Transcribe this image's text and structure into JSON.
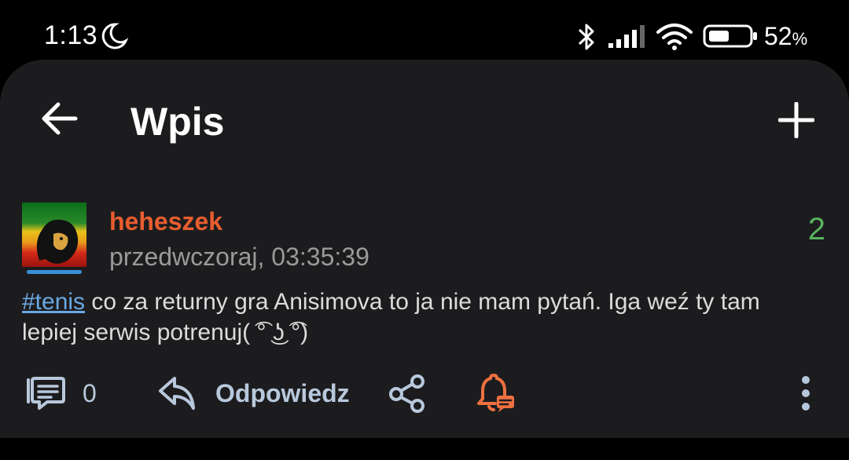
{
  "status_bar": {
    "time": "1:13",
    "battery_percent": "52",
    "battery_unit": "%",
    "battery_level": 0.52,
    "icons": [
      "moon-icon",
      "bluetooth-icon",
      "signal-icon",
      "wifi-icon",
      "battery-icon"
    ]
  },
  "header": {
    "title": "Wpis",
    "back_icon": "arrow-left-icon",
    "add_icon": "plus-icon"
  },
  "entry": {
    "username": "heheszek",
    "timestamp": "przedwczoraj, 03:35:39",
    "votes": "2",
    "tag": "#tenis",
    "text": " co za returny gra Anisimova to ja nie mam pytań. Iga weź ty tam lepiej serwis potrenuj( ͡° ͜ʖ ͡°)"
  },
  "actions": {
    "comments_count": "0",
    "reply_label": "Odpowiedz"
  },
  "colors": {
    "background": "#000000",
    "sheet": "#1c1c1e",
    "username": "#e85d2f",
    "votes": "#59b35f",
    "tag": "#6aa9e3",
    "action": "#b8c8dc",
    "bell": "#ef7040"
  }
}
